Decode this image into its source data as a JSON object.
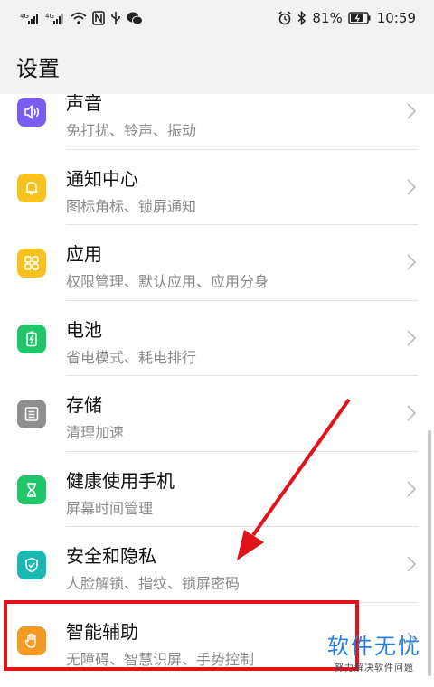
{
  "status_bar": {
    "battery": "81%",
    "time": "10:59"
  },
  "header": {
    "title": "设置"
  },
  "items": [
    {
      "label": "声音",
      "sub": "免打扰、铃声、振动",
      "icon": "speaker-icon",
      "color": "#7b5cf0"
    },
    {
      "label": "通知中心",
      "sub": "图标角标、锁屏通知",
      "icon": "bell-icon",
      "color": "#f8c21c"
    },
    {
      "label": "应用",
      "sub": "权限管理、默认应用、应用分身",
      "icon": "apps-grid-icon",
      "color": "#f8c21c"
    },
    {
      "label": "电池",
      "sub": "省电模式、耗电排行",
      "icon": "battery-icon",
      "color": "#1fc66a"
    },
    {
      "label": "存储",
      "sub": "清理加速",
      "icon": "storage-icon",
      "color": "#8e8e8e"
    },
    {
      "label": "健康使用手机",
      "sub": "屏幕时间管理",
      "icon": "hourglass-icon",
      "color": "#1fc66a"
    },
    {
      "label": "安全和隐私",
      "sub": "人脸解锁、指纹、锁屏密码",
      "icon": "shield-icon",
      "color": "#19b9b1"
    },
    {
      "label": "智能辅助",
      "sub": "无障碍、智慧识屏、手势控制",
      "icon": "hand-icon",
      "color": "#f59a23"
    }
  ],
  "watermark": {
    "main": "软件无忧",
    "sub": "努力解决软件问题"
  },
  "colors": {
    "annotation": "#e0131b"
  }
}
